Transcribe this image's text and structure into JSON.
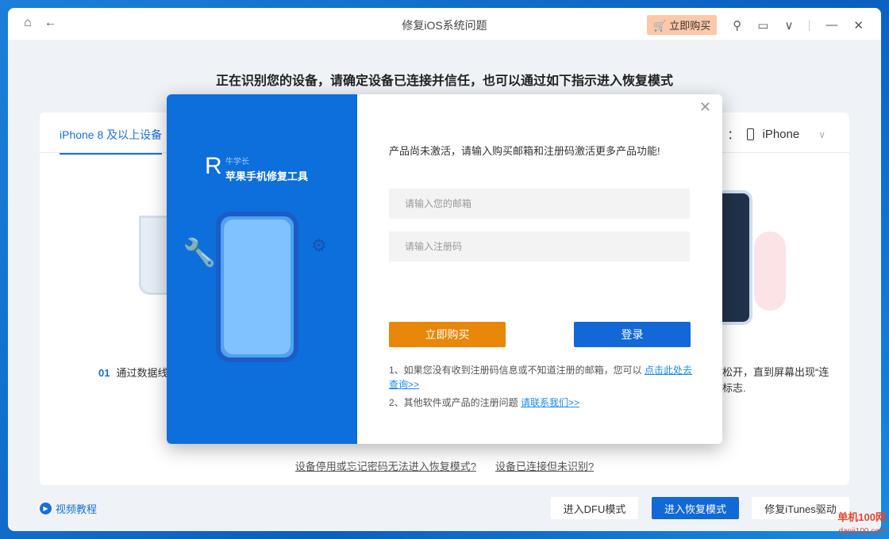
{
  "window": {
    "title": "修复iOS系统问题",
    "buy_label": "立即购买"
  },
  "main": {
    "heading": "正在识别您的设备，请确定设备已连接并信任，也可以通过如下指示进入恢复模式",
    "tab": "iPhone 8 及以上设备",
    "device_label_suffix": "：",
    "device": "iPhone",
    "step_num": "01",
    "step_text": "通过数据线",
    "step_right_1": "松开，直到屏幕出现“连",
    "step_right_2": "标志.",
    "link1": "设备停用或忘记密码无法进入恢复模式?",
    "link2": "设备已连接但未识别?",
    "video": "视频教程",
    "btn_dfu": "进入DFU模式",
    "btn_recovery": "进入恢复模式",
    "btn_itunes": "修复iTunes驱动"
  },
  "modal": {
    "brand_small": "牛学长",
    "brand": "苹果手机修复工具",
    "message": "产品尚未激活，请输入购买邮箱和注册码激活更多产品功能!",
    "email_placeholder": "请输入您的邮箱",
    "code_placeholder": "请输入注册码",
    "buy": "立即购买",
    "login": "登录",
    "note1": "1、如果您没有收到注册码信息或不知道注册的邮箱，您可以 ",
    "note1_link": "点击此处去查询>>",
    "note2": "2、其他软件或产品的注册问题 ",
    "note2_link": "请联系我们>>"
  },
  "colors": {
    "accent": "#1a6fd8",
    "buy": "#e8870a",
    "login": "#1268d6",
    "modal_left": "#0c6fdc"
  },
  "watermark": "单机100网 danji100.com"
}
